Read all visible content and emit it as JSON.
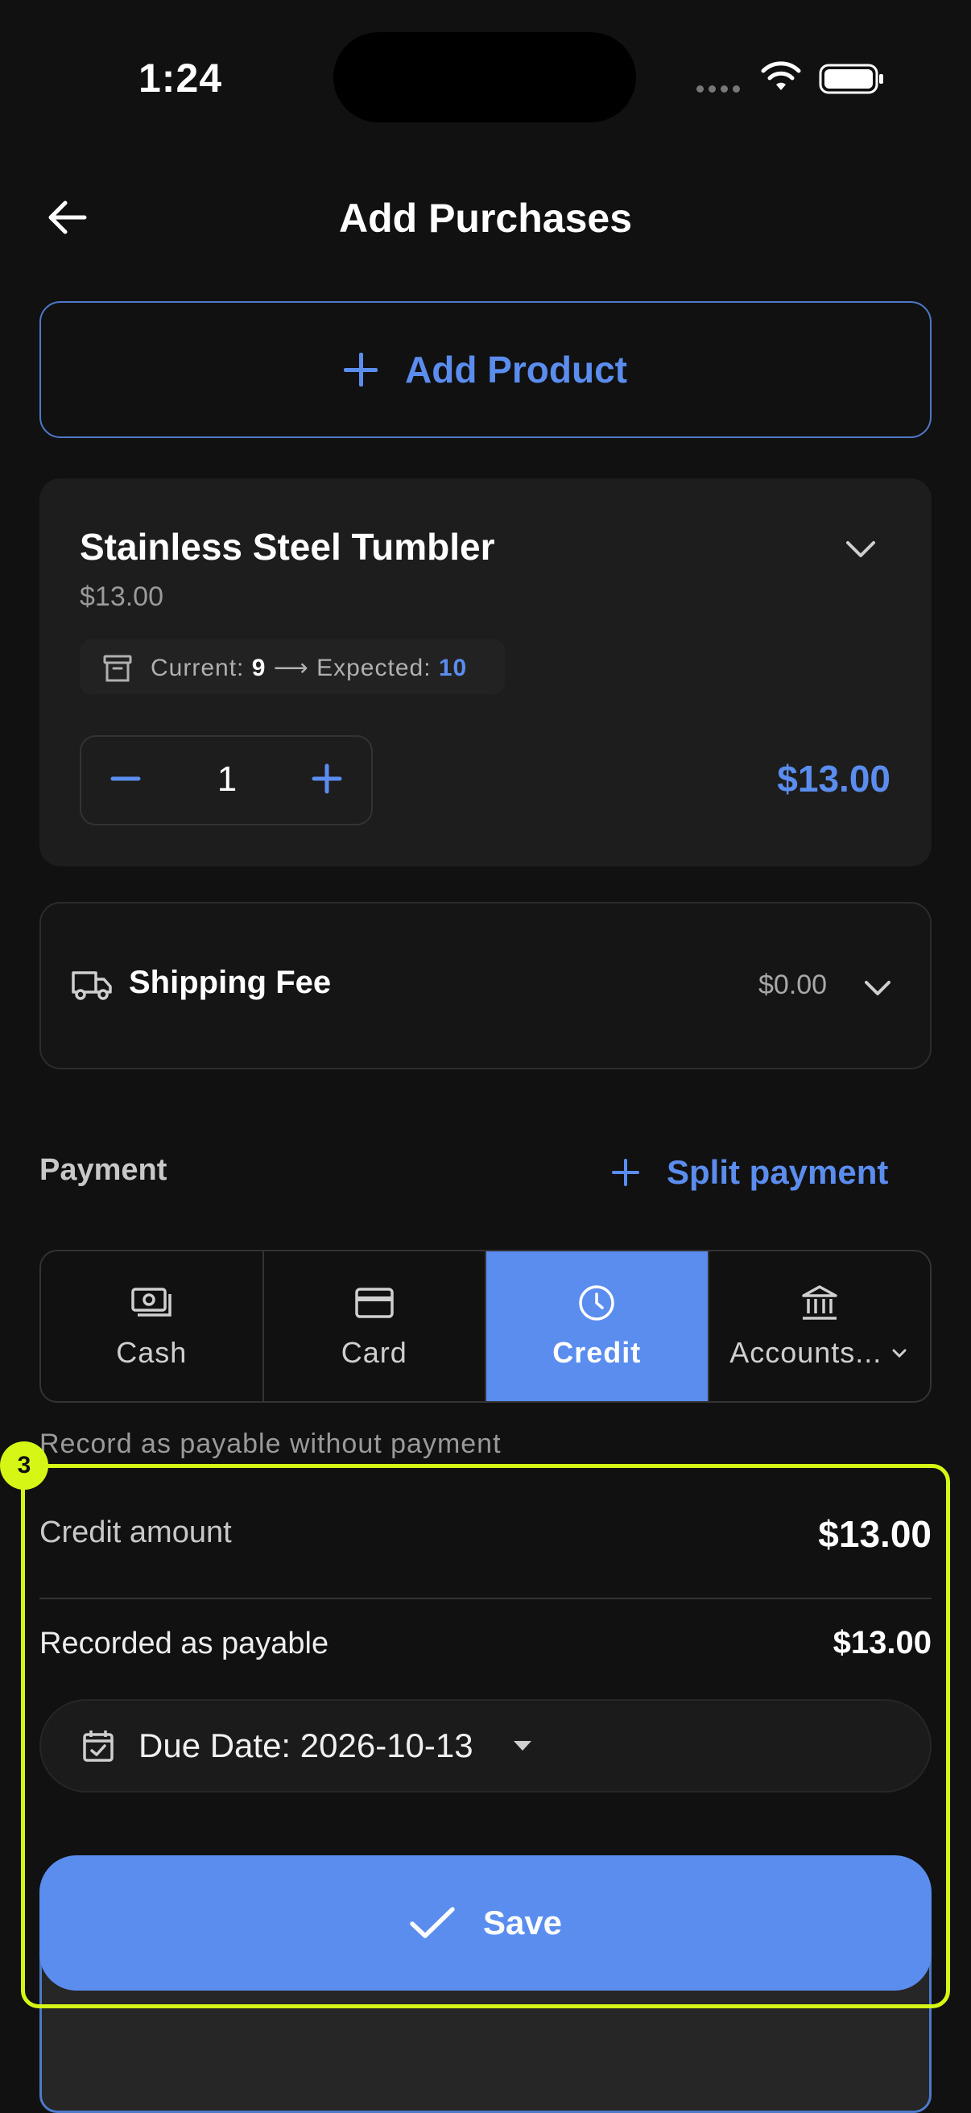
{
  "status_bar": {
    "time": "1:24"
  },
  "header": {
    "title": "Add Purchases"
  },
  "add_product": {
    "label": "Add Product"
  },
  "product": {
    "name": "Stainless Steel Tumbler",
    "price": "$13.00",
    "stock_current_label": "Current:",
    "stock_current": "9",
    "stock_expected_label": "Expected:",
    "stock_expected": "10",
    "quantity": "1",
    "line_total": "$13.00"
  },
  "shipping": {
    "label": "Shipping Fee",
    "value": "$0.00"
  },
  "payment": {
    "label": "Payment",
    "split_label": "Split payment",
    "methods": [
      {
        "label": "Cash",
        "icon": "cash-icon",
        "selected": false
      },
      {
        "label": "Card",
        "icon": "card-icon",
        "selected": false
      },
      {
        "label": "Credit",
        "icon": "clock-icon",
        "selected": true
      },
      {
        "label": "Accounts...",
        "icon": "bank-icon",
        "selected": false
      }
    ],
    "hint": "Record as payable without payment"
  },
  "highlight": {
    "badge": "3",
    "color": "#d6f716"
  },
  "credit": {
    "amount_label": "Credit amount",
    "amount_value": "$13.00",
    "payable_label": "Recorded as payable",
    "payable_value": "$13.00",
    "due_date": "Due Date: 2026-10-13"
  },
  "save": {
    "label": "Save"
  },
  "colors": {
    "accent": "#5b8def",
    "background": "#111111",
    "surface": "#1d1d1d"
  }
}
